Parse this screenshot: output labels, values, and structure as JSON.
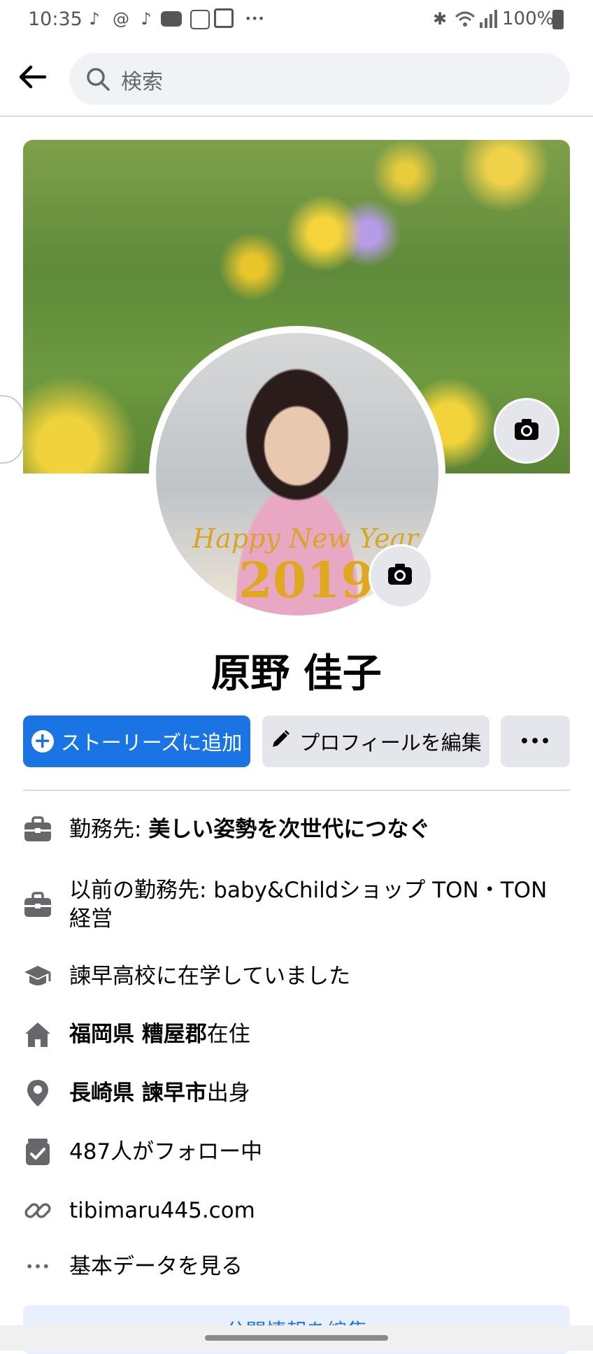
{
  "status_bar": {
    "time": "10:35",
    "battery": "100%",
    "icons": [
      "tiktok-icon",
      "threads-icon",
      "tiktok-icon",
      "youtube-icon",
      "tiktok-lite-icon",
      "news-icon",
      "more-icon",
      "bluetooth-icon",
      "wifi-icon",
      "signal-icon",
      "battery-icon"
    ]
  },
  "header": {
    "search_placeholder": "検索"
  },
  "profile": {
    "name": "原野 佳子",
    "avatar_text_line1": "Happy New Year",
    "avatar_text_line2": "2019"
  },
  "actions": {
    "add_story": "ストーリーズに追加",
    "edit_profile": "プロフィールを編集",
    "more": "•••"
  },
  "details": {
    "work_prefix": "勤務先: ",
    "work_value": "美しい姿勢を次世代につなぐ",
    "prev_work": "以前の勤務先: baby&Childショップ TON・TON経営",
    "school": "諫早高校に在学していました",
    "lives_bold": "福岡県 糟屋郡",
    "lives_suffix": "在住",
    "from_bold": "長崎県 諫早市",
    "from_suffix": "出身",
    "followers": "487人がフォロー中",
    "website": "tibimaru445.com",
    "see_about": "基本データを見る"
  },
  "footer": {
    "edit_public": "公開情報を編集"
  },
  "colors": {
    "primary": "#1b74e4",
    "button_gray": "#e4e6eb",
    "icon_gray": "#65676b"
  }
}
